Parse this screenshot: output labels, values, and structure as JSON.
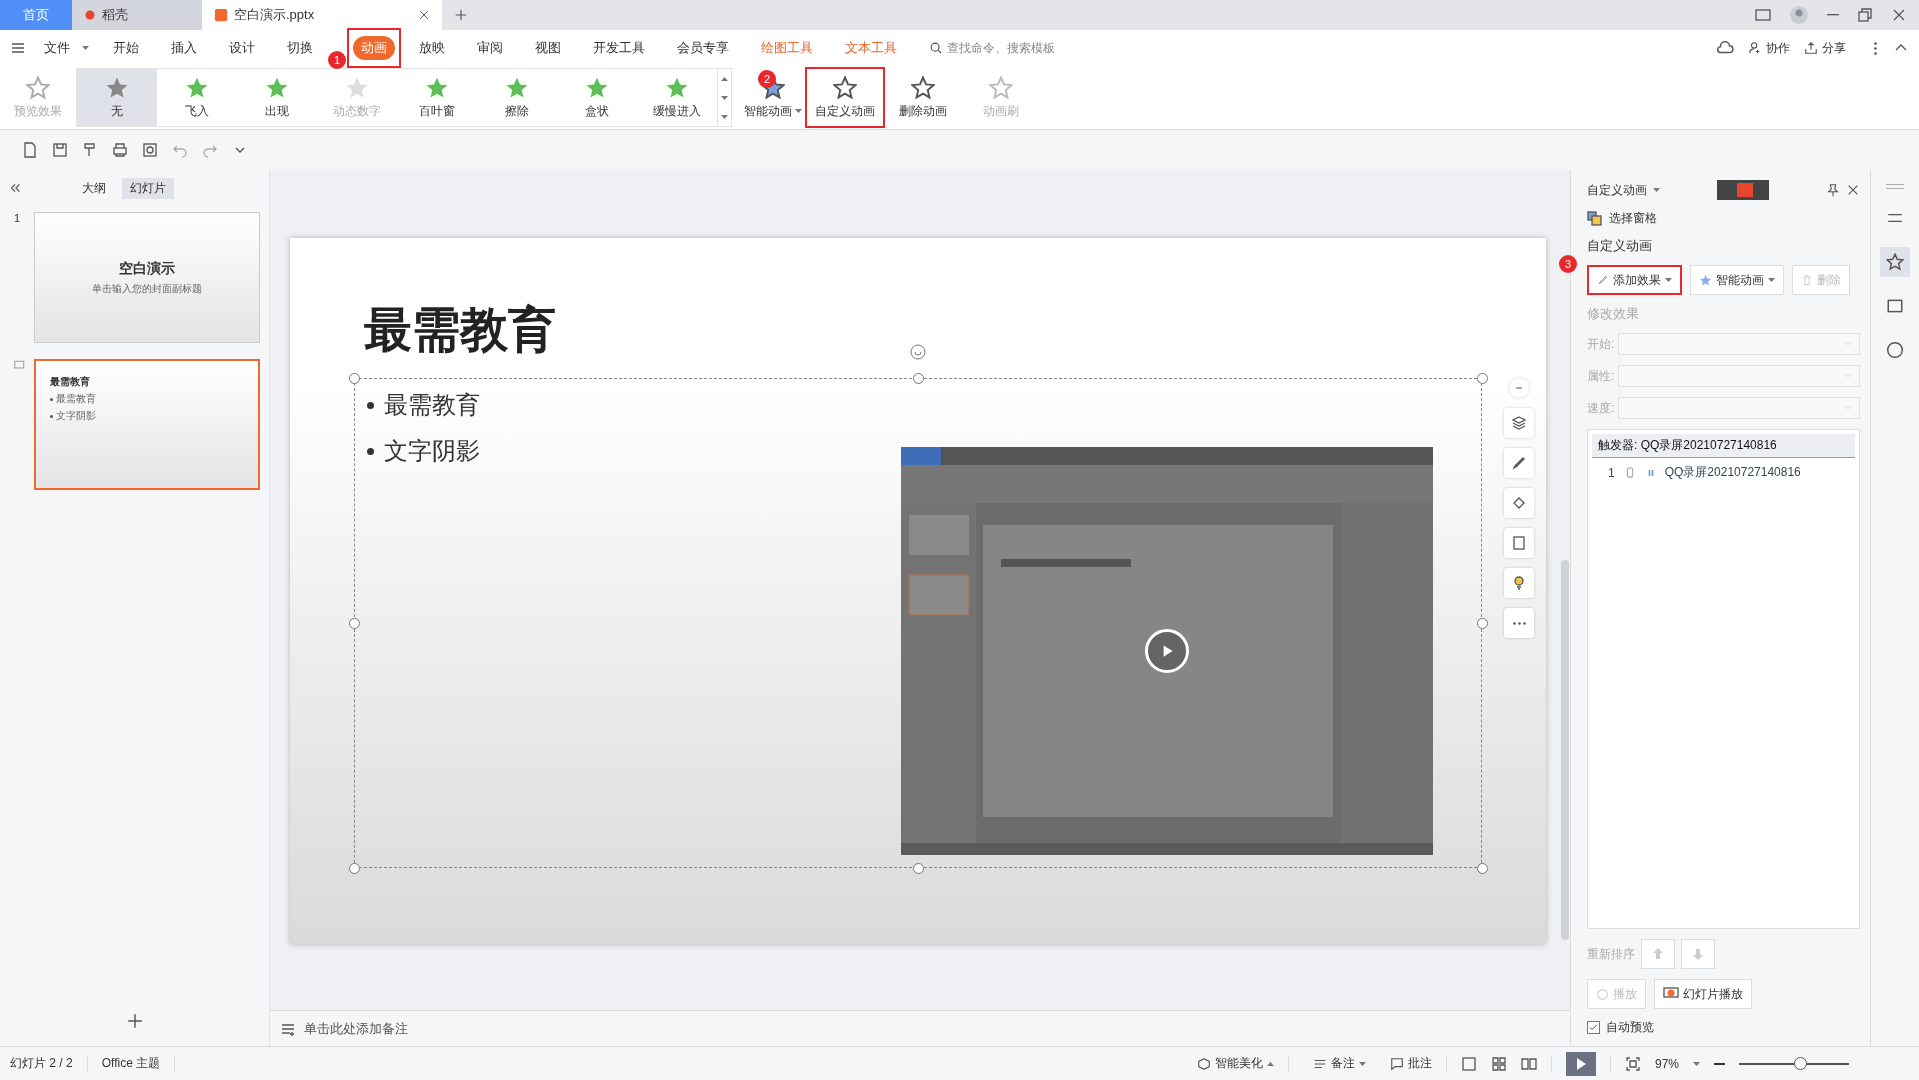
{
  "tabs": [
    {
      "label": "首页",
      "kind": "home",
      "selected": false
    },
    {
      "label": "稻壳",
      "kind": "docer",
      "selected": false
    },
    {
      "label": "空白演示.pptx",
      "kind": "file",
      "selected": true
    }
  ],
  "menu": [
    {
      "label": "文件",
      "kind": "file",
      "selected": false,
      "highlighted": false
    },
    {
      "label": "开始",
      "kind": "tab",
      "selected": false,
      "highlighted": false
    },
    {
      "label": "插入",
      "kind": "tab",
      "selected": false,
      "highlighted": false
    },
    {
      "label": "设计",
      "kind": "tab",
      "selected": false,
      "highlighted": false
    },
    {
      "label": "切换",
      "kind": "tab",
      "selected": false,
      "highlighted": false
    },
    {
      "label": "动画",
      "kind": "tab",
      "selected": true,
      "highlighted": true,
      "callout": "1"
    },
    {
      "label": "放映",
      "kind": "tab",
      "selected": false,
      "highlighted": false
    },
    {
      "label": "审阅",
      "kind": "tab",
      "selected": false,
      "highlighted": false
    },
    {
      "label": "视图",
      "kind": "tab",
      "selected": false,
      "highlighted": false
    },
    {
      "label": "开发工具",
      "kind": "tab",
      "selected": false,
      "highlighted": false
    },
    {
      "label": "会员专享",
      "kind": "tab",
      "selected": false,
      "highlighted": false
    },
    {
      "label": "绘图工具",
      "kind": "context",
      "selected": false,
      "highlighted": false
    },
    {
      "label": "文本工具",
      "kind": "context",
      "selected": false,
      "highlighted": false
    }
  ],
  "search": {
    "placeholder": "查找命令、搜索模板"
  },
  "account_actions": [
    {
      "label": "协作",
      "kind": "collab"
    },
    {
      "label": "分享",
      "kind": "share"
    }
  ],
  "ribbon": {
    "preview": {
      "label": "预览效果",
      "disabled": true
    },
    "effects": [
      {
        "label": "无",
        "selected": true,
        "disabled": false
      },
      {
        "label": "飞入",
        "selected": false,
        "disabled": false
      },
      {
        "label": "出现",
        "selected": false,
        "disabled": false
      },
      {
        "label": "动态数字",
        "selected": false,
        "disabled": true
      },
      {
        "label": "百叶窗",
        "selected": false,
        "disabled": false
      },
      {
        "label": "擦除",
        "selected": false,
        "disabled": false
      },
      {
        "label": "盒状",
        "selected": false,
        "disabled": false
      },
      {
        "label": "缓慢进入",
        "selected": false,
        "disabled": false
      }
    ],
    "tools": [
      {
        "label": "智能动画",
        "kind": "smart",
        "disabled": false,
        "highlighted": false,
        "callout": "2"
      },
      {
        "label": "自定义动画",
        "kind": "custom",
        "disabled": false,
        "highlighted": true
      },
      {
        "label": "删除动画",
        "kind": "delete",
        "disabled": false,
        "highlighted": false
      },
      {
        "label": "动画刷",
        "kind": "brush",
        "disabled": true,
        "highlighted": false
      }
    ]
  },
  "outline_tabs": [
    {
      "label": "大纲",
      "selected": false
    },
    {
      "label": "幻灯片",
      "selected": true
    }
  ],
  "thumbnails": [
    {
      "number": "1",
      "kind": "title",
      "title": "空白演示",
      "subtitle": "单击输入您的封面副标题",
      "selected": false
    },
    {
      "kind": "content",
      "title": "最需教育",
      "bullets": [
        "最需教育",
        "文字阴影"
      ],
      "selected": true
    }
  ],
  "slide": {
    "title": "最需教育",
    "bullets": [
      "最需教育",
      "文字阴影"
    ],
    "media": {
      "kind": "picture"
    }
  },
  "notes": {
    "placeholder": "单击此处添加备注"
  },
  "pane": {
    "title": "自定义动画",
    "select_pane": "选择窗格",
    "section": "自定义动画",
    "actions": [
      {
        "label": "添加效果",
        "kind": "add",
        "disabled": false,
        "highlighted": true,
        "callout": "3"
      },
      {
        "label": "智能动画",
        "kind": "smart",
        "disabled": false,
        "highlighted": false
      },
      {
        "label": "删除",
        "kind": "delete",
        "disabled": true,
        "highlighted": false
      }
    ],
    "modify": {
      "label": "修改效果",
      "fields": [
        "开始:",
        "属性:",
        "速度:"
      ]
    },
    "list": {
      "header": "触发器: QQ录屏20210727140816",
      "items": [
        {
          "number": "1",
          "name": "QQ录屏20210727140816"
        }
      ]
    },
    "reorder": "重新排序",
    "play": {
      "label": "播放",
      "disabled": true
    },
    "slideshow": "幻灯片播放",
    "auto_preview": {
      "label": "自动预览",
      "checked": true
    }
  },
  "status": {
    "slide": "幻灯片 2 / 2",
    "theme": "Office 主题",
    "beautify": "智能美化",
    "notes": "备注",
    "comments": "批注",
    "zoom": "97%",
    "zoom_slider": {
      "level": 0.55
    }
  }
}
